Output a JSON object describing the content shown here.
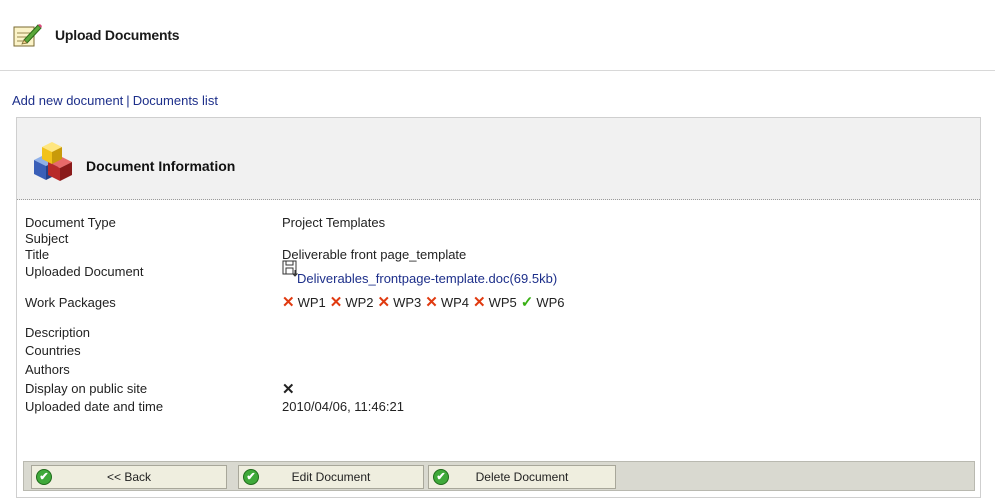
{
  "header": {
    "title": "Upload Documents",
    "icon": "notepad-pencil-icon"
  },
  "nav": {
    "add_new": "Add new document",
    "separator": "|",
    "list": "Documents list"
  },
  "panel": {
    "title": "Document Information",
    "icon": "boxes-icon",
    "fields": {
      "document_type": {
        "label": "Document Type",
        "value": "Project Templates"
      },
      "subject": {
        "label": "Subject",
        "value": ""
      },
      "title": {
        "label": "Title",
        "value": "Deliverable front page_template"
      },
      "uploaded_document": {
        "label": "Uploaded Document",
        "value": "Deliverables_frontpage-template.doc(69.5kb)",
        "icon": "save-disk-icon"
      },
      "work_packages": {
        "label": "Work Packages",
        "items": [
          {
            "name": "WP1",
            "status": "no"
          },
          {
            "name": "WP2",
            "status": "no"
          },
          {
            "name": "WP3",
            "status": "no"
          },
          {
            "name": "WP4",
            "status": "no"
          },
          {
            "name": "WP5",
            "status": "no"
          },
          {
            "name": "WP6",
            "status": "yes"
          }
        ]
      },
      "description": {
        "label": "Description",
        "value": ""
      },
      "countries": {
        "label": "Countries",
        "value": ""
      },
      "authors": {
        "label": "Authors",
        "value": ""
      },
      "display_public": {
        "label": "Display on public site",
        "status": "no"
      },
      "uploaded_datetime": {
        "label": "Uploaded date and time",
        "value": "2010/04/06, 11:46:21"
      }
    }
  },
  "buttons": {
    "back": "<< Back",
    "edit": "Edit Document",
    "delete": "Delete Document"
  },
  "symbols": {
    "x": "✕",
    "check": "✓",
    "ok": "✔"
  },
  "colors": {
    "link": "#1d2f8a",
    "x_mark": "#e03a10",
    "check_mark": "#39b014",
    "button_bar": "#d9d9d0"
  }
}
